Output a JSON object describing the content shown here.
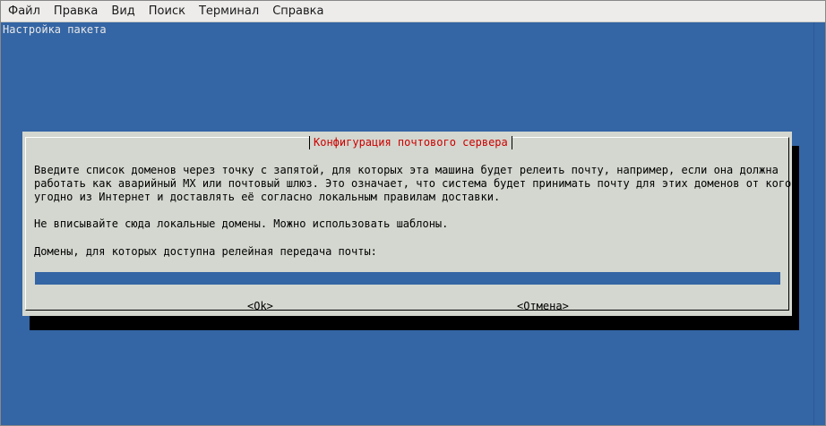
{
  "menubar": {
    "items": [
      {
        "label": "Файл"
      },
      {
        "label": "Правка"
      },
      {
        "label": "Вид"
      },
      {
        "label": "Поиск"
      },
      {
        "label": "Терминал"
      },
      {
        "label": "Справка"
      }
    ]
  },
  "terminal": {
    "title": "Настройка пакета"
  },
  "dialog": {
    "title": "Конфигурация почтового сервера",
    "paragraph1_line1": "Введите список доменов через точку с запятой, для которых эта машина будет релеить почту, например, если она должна",
    "paragraph1_line2": "работать как аварийный MX или почтовый шлюз. Это означает, что система будет принимать почту для этих доменов от кого",
    "paragraph1_line3": "угодно из Интернет и доставлять её согласно локальным правилам доставки.",
    "paragraph2": "Не вписывайте сюда локальные домены. Можно использовать шаблоны.",
    "prompt": "Домены, для которых доступна релейная передача почты:",
    "input_value": "",
    "ok_label": "<Ok>",
    "cancel_label": "<Отмена>"
  },
  "colors": {
    "terminal_bg": "#3465a4",
    "dialog_bg": "#d3d7cf",
    "title_color": "#cc0000"
  }
}
